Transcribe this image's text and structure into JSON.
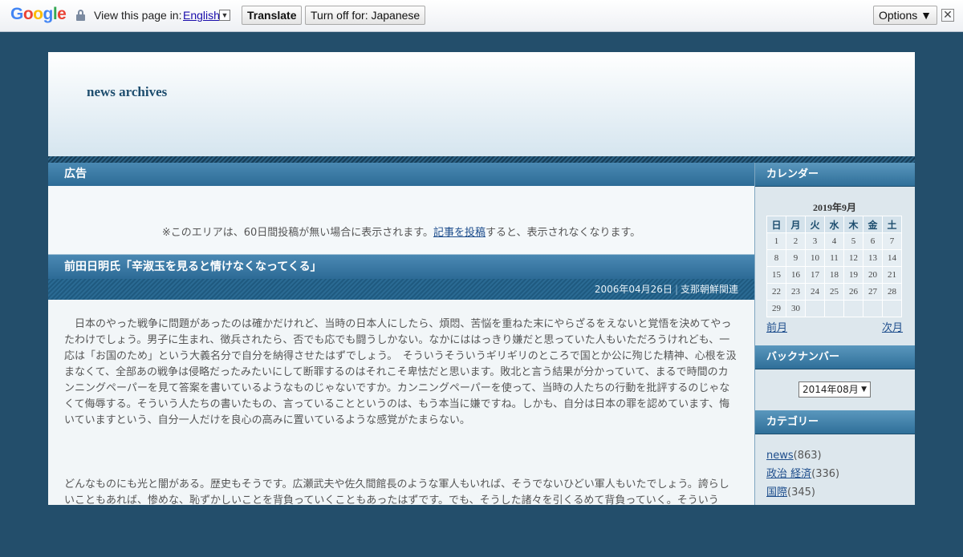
{
  "translate_bar": {
    "logo": "Google",
    "view_in_label": "View this page in:",
    "language": "English",
    "translate_button": "Translate",
    "turn_off_button": "Turn off for: Japanese",
    "options_button": "Options ▼",
    "close_glyph": "✕"
  },
  "site": {
    "title": "news archives"
  },
  "ad": {
    "heading": "広告",
    "note_before": "※このエリアは、60日間投稿が無い場合に表示されます。",
    "note_link": "記事を投稿",
    "note_after": "すると、表示されなくなります。"
  },
  "post": {
    "title": "前田日明氏「辛淑玉を見ると情けなくなってくる」",
    "date": "2006年04月26日",
    "separator": "|",
    "category": "支那朝鮮関連",
    "paragraph1": "　日本のやった戦争に問題があったのは確かだけれど、当時の日本人にしたら、煩悶、苦悩を重ねた末にやらざるをえないと覚悟を決めてやったわけでしょう。男子に生まれ、徴兵されたら、否でも応でも闘うしかない。なかにははっきり嫌だと思っていた人もいただろうけれども、一応は「お国のため」という大義名分で自分を納得させたはずでしょう。　そういうそういうギリギリのところで国とか公に殉じた精神、心根を汲まなくて、全部あの戦争は侵略だったみたいにして断罪するのはそれこそ卑怯だと思います。敗北と言う結果が分かっていて、まるで時間のカンニングペーパーを見て答案を書いているようなものじゃないですか。カンニングペーパーを使って、当時の人たちの行動を批評するのじゃなくて侮辱する。そういう人たちの書いたもの、言っていることというのは、もう本当に嫌ですね。しかも、自分は日本の罪を認めています、悔いていますという、自分一人だけを良心の高みに置いているような感覚がたまらない。",
    "paragraph2": "どんなものにも光と闇がある。歴史もそうです。広瀬武夫や佐久間館長のような軍人もいれば、そうでないひどい軍人もいたでしょう。誇らしいこともあれば、惨めな、恥ずかしいことを背負っていくこともあったはずです。でも、そうした諸々を引くるめて背負っていく。そういう"
  },
  "sidebar": {
    "calendar_heading": "カレンダー",
    "calendar_caption": "2019年9月",
    "weekdays": [
      "日",
      "月",
      "火",
      "水",
      "木",
      "金",
      "土"
    ],
    "weeks": [
      [
        "1",
        "2",
        "3",
        "4",
        "5",
        "6",
        "7"
      ],
      [
        "8",
        "9",
        "10",
        "11",
        "12",
        "13",
        "14"
      ],
      [
        "15",
        "16",
        "17",
        "18",
        "19",
        "20",
        "21"
      ],
      [
        "22",
        "23",
        "24",
        "25",
        "26",
        "27",
        "28"
      ],
      [
        "29",
        "30",
        "",
        "",
        "",
        "",
        ""
      ]
    ],
    "prev_month": "前月",
    "next_month": "次月",
    "backnumber_heading": "バックナンバー",
    "backnumber_selected": "2014年08月",
    "category_heading": "カテゴリー",
    "categories": [
      {
        "name": "news",
        "count": "(863)"
      },
      {
        "name": "政治 経済",
        "count": "(336)"
      },
      {
        "name": "国際",
        "count": "(345)"
      }
    ]
  },
  "colors": {
    "page_background": "#234e6b",
    "bar_blue": "#2d6b96",
    "link_blue": "#1d4d8c"
  }
}
